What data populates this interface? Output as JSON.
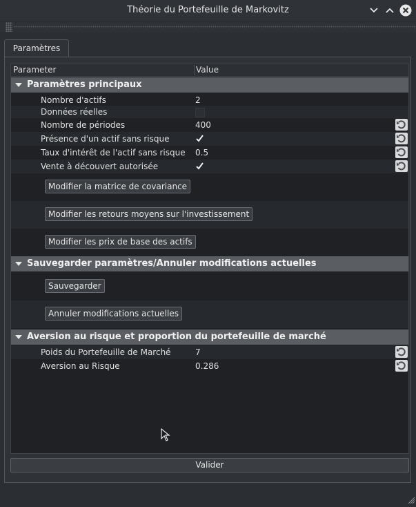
{
  "window": {
    "title": "Théorie du Portefeuille de Markovitz"
  },
  "tabs": [
    {
      "label": "Paramètres"
    }
  ],
  "table": {
    "headers": {
      "param": "Parameter",
      "value": "Value"
    },
    "sections": [
      {
        "title": "Paramètres principaux"
      },
      {
        "title": "Sauvegarder paramètres/Annuler modifications actuelles"
      },
      {
        "title": "Aversion au risque et proportion du portefeuille de marché"
      }
    ],
    "rows": [
      {
        "label": "Nombre d'actifs",
        "value": "2"
      },
      {
        "label": "Données réelles",
        "checked": false
      },
      {
        "label": "Nombre de périodes",
        "value": "400"
      },
      {
        "label": "Présence d'un actif sans risque",
        "checked": true
      },
      {
        "label": "Taux d'intérêt de l'actif sans risque",
        "value": "0.5"
      },
      {
        "label": "Vente à découvert autorisée",
        "checked": true
      },
      {
        "label": "Poids du Portefeuille de Marché",
        "value": "7"
      },
      {
        "label": "Aversion au Risque",
        "value": "0.286"
      }
    ],
    "buttons": {
      "cov": "Modifier la matrice de covariance",
      "returns": "Modifier les retours moyens sur l'investissement",
      "prices": "Modifier les prix de base des actifs",
      "save": "Sauvegarder",
      "cancel": "Annuler modifications actuelles"
    }
  },
  "footer": {
    "validate_label": "Valider"
  },
  "icons": {
    "minimize": "chevron-down-icon",
    "maximize": "chevron-up-icon",
    "close": "close-icon",
    "reset": "undo-icon",
    "check": "checkmark-icon"
  }
}
